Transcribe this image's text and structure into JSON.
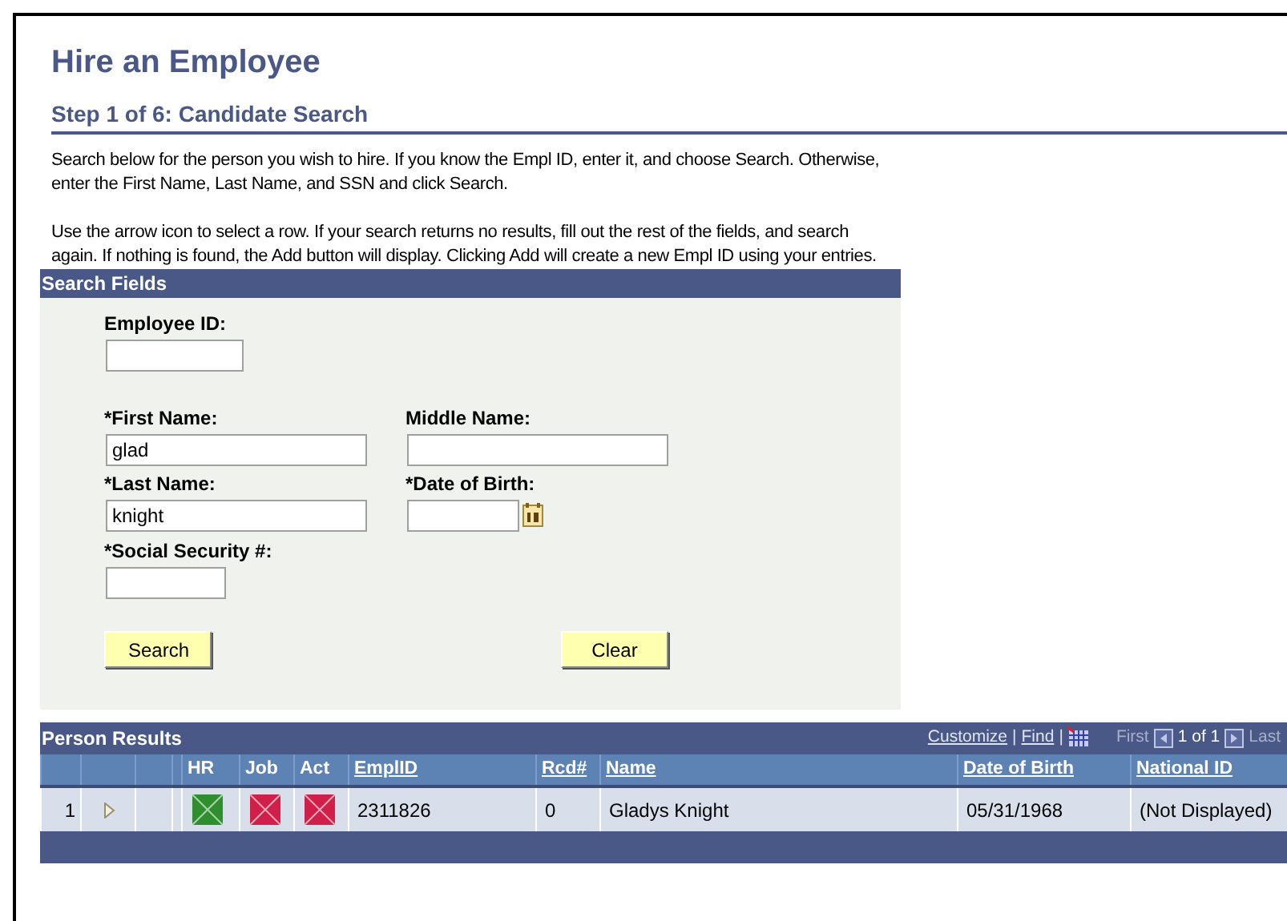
{
  "page": {
    "title": "Hire an Employee",
    "step_title": "Step 1 of 6: Candidate Search",
    "instructions": [
      "Search below for the person you wish to hire. If you know the Empl ID, enter it, and choose Search. Otherwise, enter the First Name, Last Name, and SSN and click Search.",
      "Use the arrow icon to select a row. If your search returns no results, fill out the rest of the fields, and search again. If nothing is found, the Add button will display. Clicking Add will create a new Empl ID using your entries."
    ]
  },
  "search_fields": {
    "title": "Search Fields",
    "employee_id": {
      "label": "Employee ID:"
    },
    "first_name": {
      "label": "*First Name:",
      "value": "glad"
    },
    "middle_name": {
      "label": "Middle Name:"
    },
    "last_name": {
      "label": "*Last Name:",
      "value": "knight"
    },
    "date_of_birth": {
      "label": "*Date of Birth:"
    },
    "ssn": {
      "label": "*Social Security #:"
    },
    "buttons": [
      "Search",
      "Clear"
    ]
  },
  "person_results": {
    "title": "Person Results",
    "toolbar": {
      "customize": "Customize",
      "separator_1": "|",
      "find": "Find",
      "separator_2": "|",
      "first": {
        "label": "First",
        "disabled": true
      },
      "page": "1 of 1",
      "last": {
        "label": "Last",
        "disabled": true
      }
    },
    "columns": [
      {
        "label": "HR",
        "sortable": false
      },
      {
        "label": "Job",
        "sortable": false
      },
      {
        "label": "Act",
        "sortable": false
      },
      {
        "label": "EmplID",
        "sortable": true
      },
      {
        "label": "Rcd#",
        "sortable": true
      },
      {
        "label": "Name",
        "sortable": true
      },
      {
        "label": "Date of Birth",
        "sortable": true
      },
      {
        "label": "National ID",
        "sortable": true
      }
    ],
    "rows": [
      {
        "number": "1",
        "cells": [
          {
            "kind": "status",
            "color": "#2f8f2f"
          },
          {
            "kind": "status",
            "color": "#d0204a"
          },
          {
            "kind": "status",
            "color": "#d0204a"
          },
          {
            "kind": "text",
            "text": "2311826"
          },
          {
            "kind": "text",
            "text": "0"
          },
          {
            "kind": "text",
            "text": "Gladys Knight"
          },
          {
            "kind": "text",
            "text": "05/31/1968"
          },
          {
            "kind": "text",
            "text": "(Not Displayed)"
          }
        ]
      }
    ]
  }
}
